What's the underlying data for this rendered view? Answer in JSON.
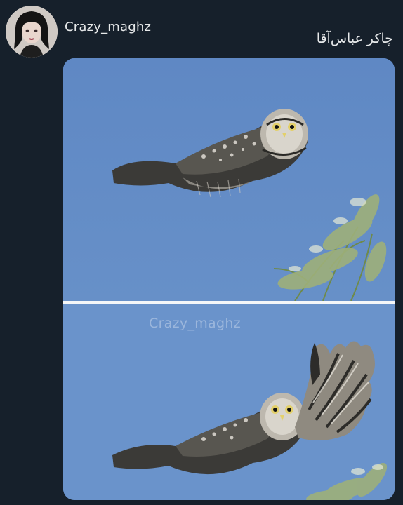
{
  "post": {
    "username": "Crazy_maghz",
    "text": "چاکر عباس‌آقا"
  },
  "media": {
    "watermark": "Crazy_maghz"
  },
  "colors": {
    "background": "#16202b",
    "sky": "#5e87c2",
    "text": "#e7e9ea"
  }
}
